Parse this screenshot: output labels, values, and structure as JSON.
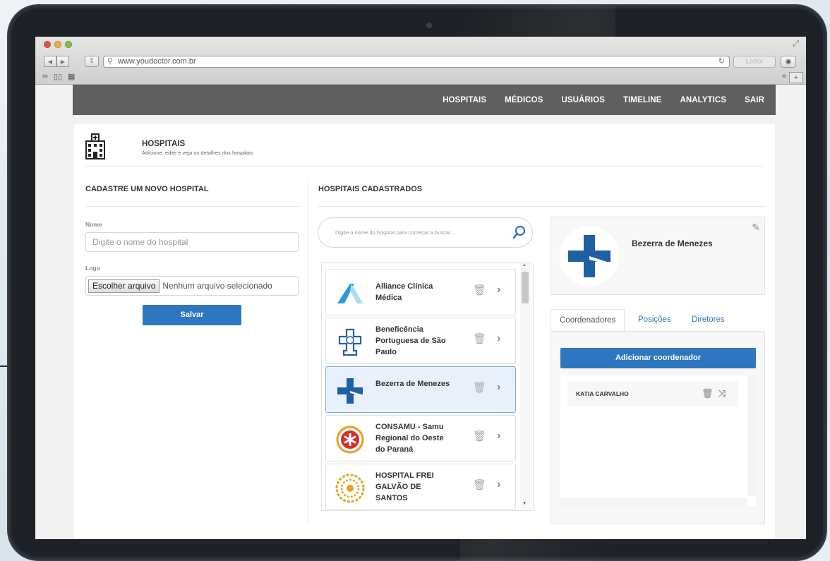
{
  "browser": {
    "url": "www.youdoctor.com.br",
    "reader_label": "Leitor"
  },
  "nav": {
    "items": [
      "HOSPITAIS",
      "MÉDICOS",
      "USUÁRIOS",
      "TIMELINE",
      "ANALYTICS",
      "SAIR"
    ]
  },
  "header": {
    "title": "HOSPITAIS",
    "subtitle": "Adicione, edite e veja os detalhes dos hospitais"
  },
  "form": {
    "section_title": "CADASTRE UM NOVO HOSPITAL",
    "name_label": "Nome",
    "name_placeholder": "Digite o nome do hospital",
    "logo_label": "Logo",
    "file_button": "Escolher arquivo",
    "file_status": "Nenhum arquivo selecionado",
    "save_label": "Salvar"
  },
  "list": {
    "section_title": "HOSPITAIS CADASTRADOS",
    "search_placeholder": "Digite o nome do hospital para começar a buscar...",
    "items": [
      {
        "name": "Alliance Clínica Médica",
        "logo": "alliance-logo"
      },
      {
        "name": "Beneficência Portuguesa de São Paulo",
        "logo": "beneficencia-logo"
      },
      {
        "name": "Bezerra de Menezes",
        "logo": "bezerra-logo",
        "selected": true
      },
      {
        "name": "CONSAMU - Samu Regional do Oeste do Paraná",
        "logo": "consamu-logo"
      },
      {
        "name": "HOSPITAL FREI GALVÃO DE SANTOS",
        "logo": "frei-galvao-logo"
      }
    ]
  },
  "detail": {
    "name": "Bezerra de Menezes",
    "tabs": [
      "Coordenadores",
      "Posições",
      "Diretores"
    ],
    "add_button": "Adicionar coordenador",
    "coordinators": [
      "KATIA CARVALHO"
    ]
  },
  "colors": {
    "accent": "#2e77c0",
    "navbar": "#5f5f5f"
  }
}
